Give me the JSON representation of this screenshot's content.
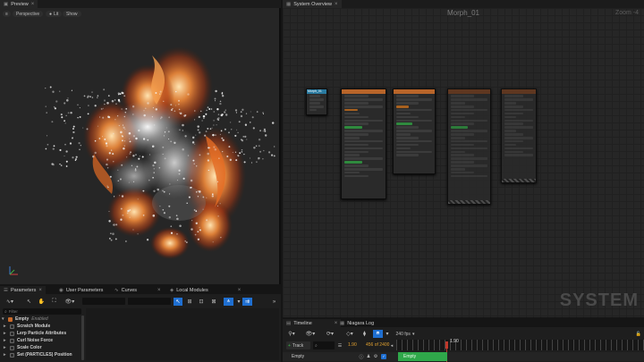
{
  "preview": {
    "tab_label": "Preview",
    "mode_label": "Perspective",
    "lit_label": "Lit",
    "show_label": "Show"
  },
  "system_overview": {
    "tab_label": "System Overview",
    "graph_title": "Morph_01",
    "zoom_label": "Zoom -4",
    "watermark": "SYSTEM",
    "emitter_node_title": "Morph_01"
  },
  "params_panel": {
    "tabs": [
      {
        "label": "Parameters"
      },
      {
        "label": "User Parameters"
      },
      {
        "label": "Curves"
      },
      {
        "label": "Local Modules"
      }
    ],
    "search_placeholder": "Filter",
    "emitter": {
      "name": "Empty",
      "state": "Enabled"
    },
    "modules": [
      {
        "label": "Scratch Module"
      },
      {
        "label": "Lerp Particle Attributes"
      },
      {
        "label": "Curl Noise Force"
      },
      {
        "label": "Scale Color"
      },
      {
        "label": "Set (PARTICLES) Position"
      }
    ]
  },
  "timeline": {
    "tabs": [
      {
        "label": "Timeline"
      },
      {
        "label": "Niagara Log"
      }
    ],
    "fps_label": "240 fps",
    "track_button": "Track",
    "current_time": "1.90",
    "frame_info": "456 of 2400",
    "playhead_label": "1.90",
    "track_name": "Empty",
    "clip_label": "Empty"
  },
  "colors": {
    "accent_blue": "#1f6fd1",
    "timeline_green": "#2fa84a",
    "playhead_red": "#c0392b",
    "fire_orange": "#e0702a"
  }
}
